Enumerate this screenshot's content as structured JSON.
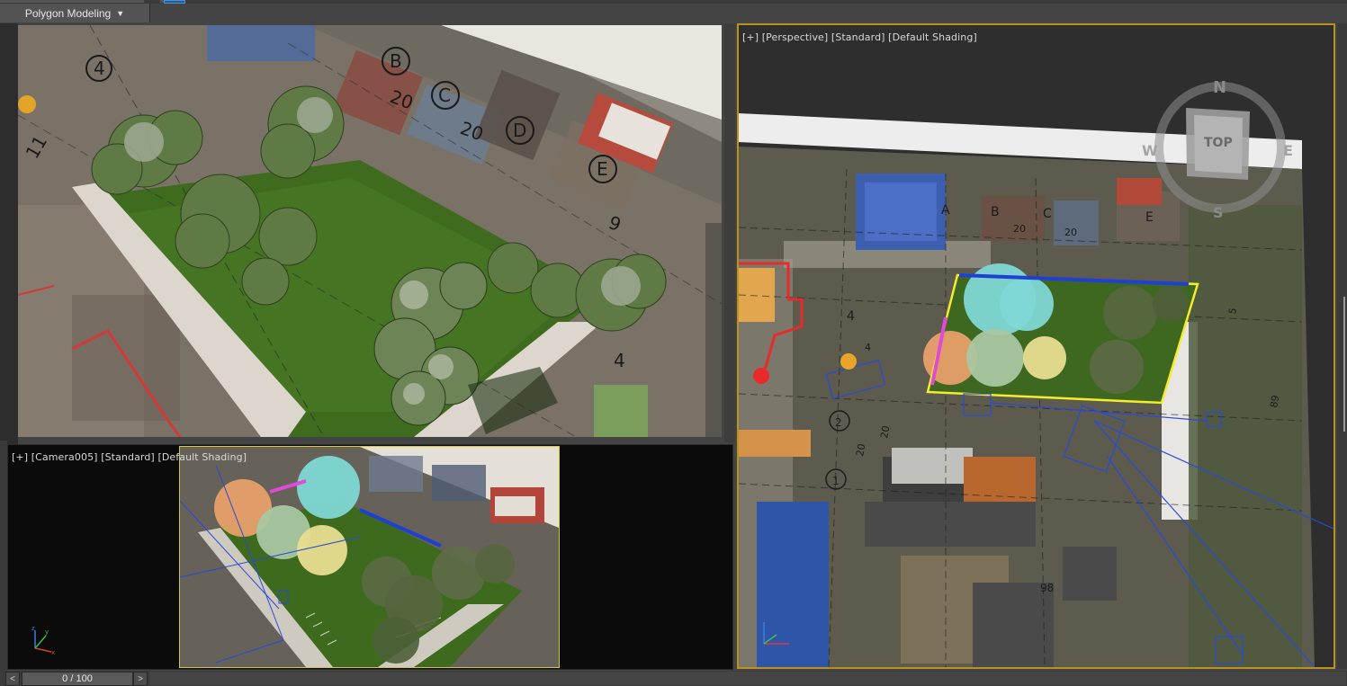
{
  "ribbon": {
    "workspace_label": "Polygon Modeling",
    "caret": "▼"
  },
  "viewports": {
    "camera": {
      "label_plus": "[+]",
      "label_view": "[Camera005]",
      "label_mode": "[Standard]",
      "label_shading": "[Default Shading]"
    },
    "perspective": {
      "label_plus": "[+]",
      "label_view": "[Perspective]",
      "label_mode": "[Standard]",
      "label_shading": "[Default Shading]",
      "viewcube": {
        "face": "TOP",
        "north": "N",
        "south": "S",
        "east": "E",
        "west": "W"
      }
    },
    "render": {}
  },
  "plan_marks": {
    "grid_letters": [
      "B",
      "C",
      "D",
      "E"
    ],
    "grid_numbers": [
      "4",
      "20",
      "20",
      "9",
      "11",
      "4"
    ],
    "persp_letters": [
      "A",
      "B",
      "C",
      "E"
    ],
    "persp_numbers": [
      "20",
      "20",
      "4",
      "4",
      "2",
      "1",
      "5",
      "89",
      "98",
      "20",
      "20"
    ]
  },
  "timeline": {
    "prev": "<",
    "next": ">",
    "frame_readout": "0 / 100"
  },
  "colors": {
    "viewport_active_border": "#b8941e",
    "selection_yellow": "#f5ec2a",
    "camera_blue": "#1f3fd6",
    "grass_green": "#3f6b1f"
  },
  "icons": [
    "axis-gizmo-icon",
    "viewcube-icon",
    "compass-ring-icon",
    "caret-down-icon"
  ]
}
